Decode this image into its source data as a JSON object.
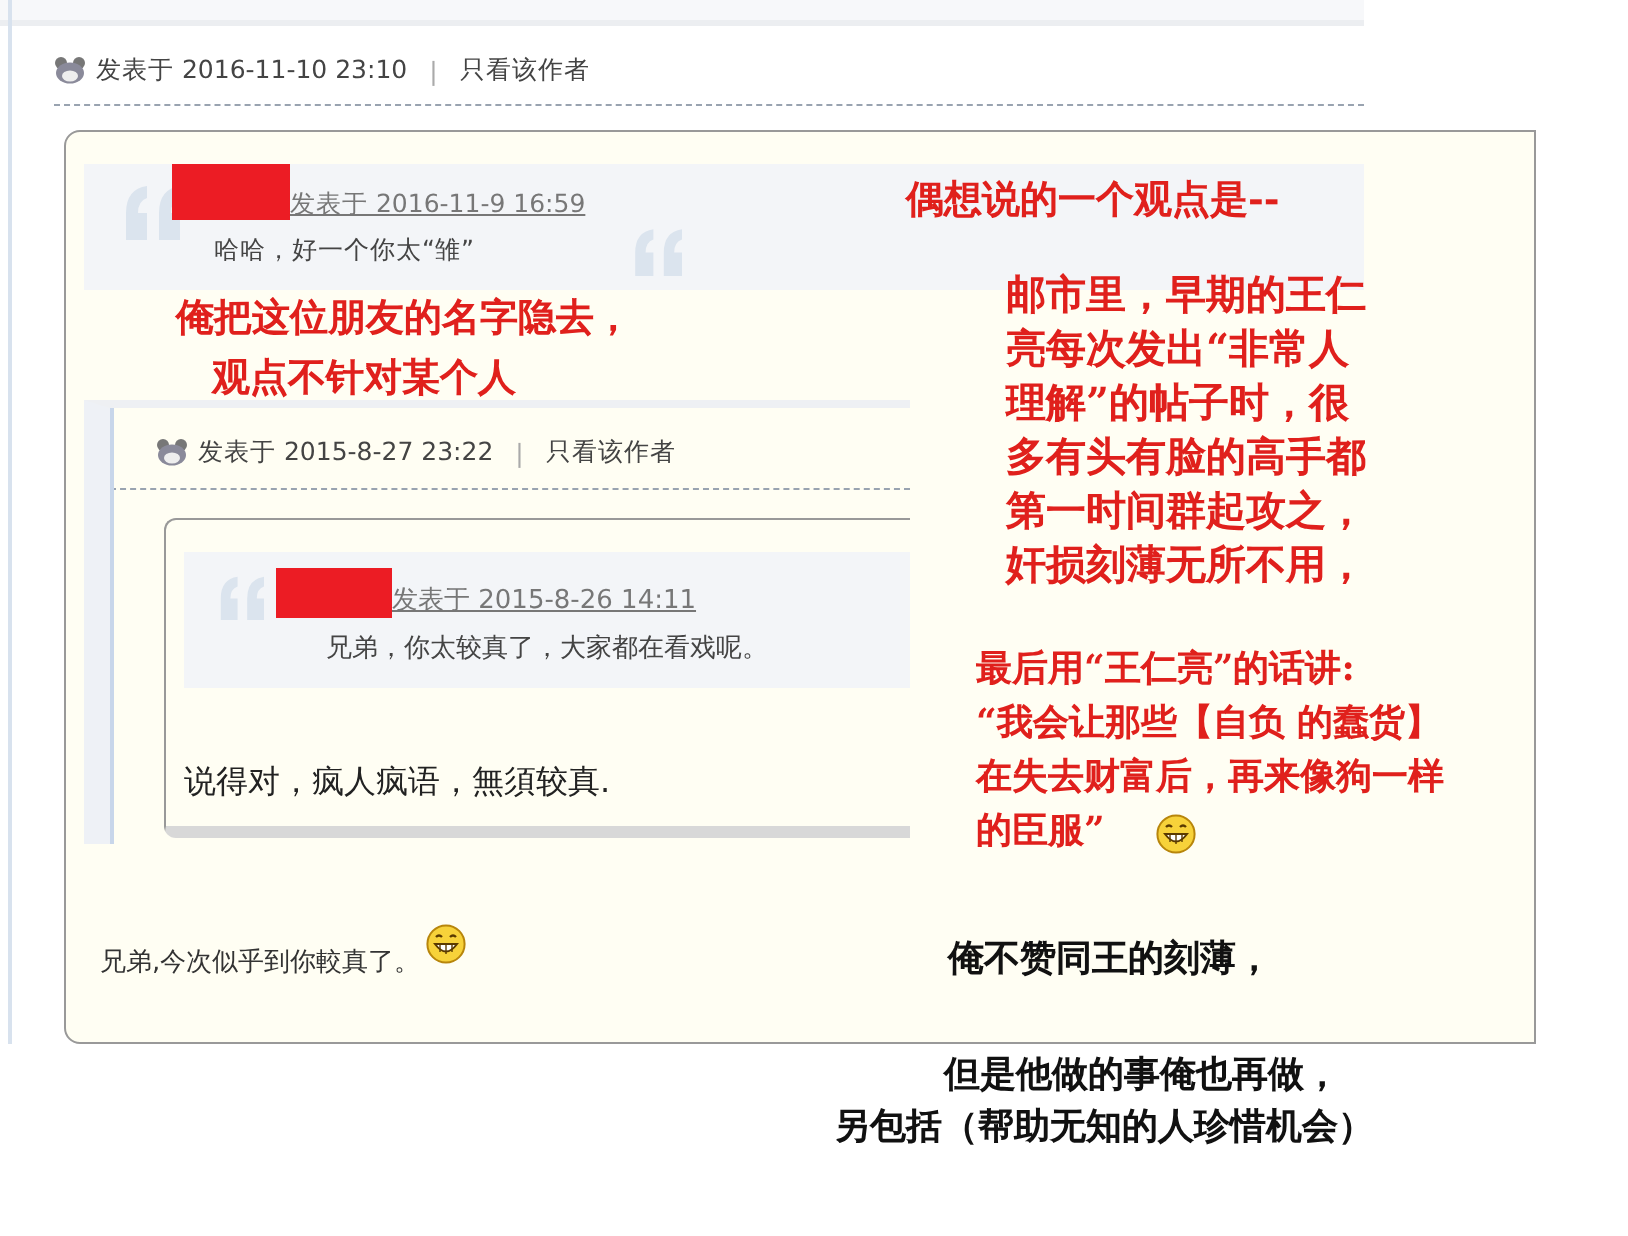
{
  "post": {
    "time": "发表于 2016-11-10 23:10",
    "separator": "|",
    "author_only": "只看该作者",
    "quote": {
      "redacted": true,
      "posted": "发表于 2016-11-9 16:59",
      "text": "哈哈，好一个你太“雏”"
    },
    "nested_post": {
      "time": "发表于 2015-8-27 23:22",
      "separator": "|",
      "author_only": "只看该作者",
      "quote": {
        "redacted": true,
        "posted": "发表于 2015-8-26 14:11",
        "text": "兄弟，你太较真了，大家都在看戏呢。"
      },
      "body": "说得对，疯人疯语，無須较真."
    },
    "body": "兄弟,今次似乎到你較真了。"
  },
  "annotations": [
    {
      "kind": "red",
      "lines": [
        "俺把这位朋友的名字隐去，"
      ]
    },
    {
      "kind": "red",
      "lines": [
        "观点不针对某个人"
      ]
    },
    {
      "kind": "red",
      "lines": [
        "偶想说的一个观点是--"
      ]
    },
    {
      "kind": "red",
      "lines": [
        "邮市里，早期的王仁",
        "亮每次发出“非常人",
        "理解”的帖子时，很",
        "多有头有脸的高手都",
        "第一时间群起攻之，",
        "奸损刻薄无所不用，"
      ]
    },
    {
      "kind": "red",
      "lines": [
        "最后用“王仁亮”的话讲:",
        "“我会让那些【自负 的蠢货】",
        "在失去财富后，再来像狗一样",
        "的臣服”"
      ]
    },
    {
      "kind": "black",
      "lines": [
        "俺不赞同王的刻薄，"
      ]
    },
    {
      "kind": "black",
      "lines": [
        "但是他做的事俺也再做，"
      ]
    },
    {
      "kind": "black",
      "lines": [
        "另包括（帮助无知的人珍惜机会）"
      ]
    }
  ]
}
